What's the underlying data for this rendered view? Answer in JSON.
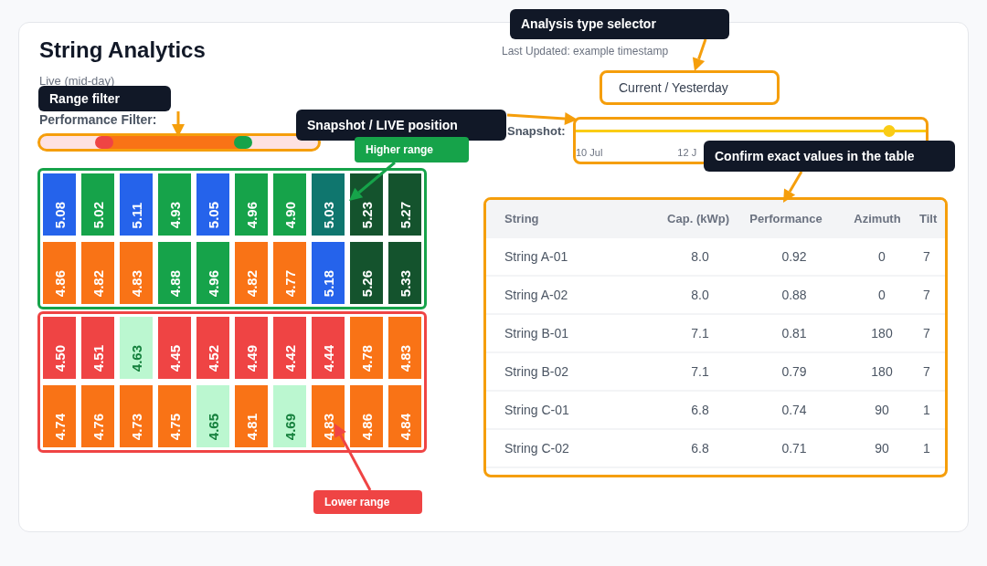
{
  "title": "String Analytics",
  "mode_label": "Live (mid-day)",
  "filter": {
    "label": "Performance Filter:",
    "thumbs": [
      {
        "level": 0.23,
        "color": "#ef4444"
      },
      {
        "level": 0.73,
        "color": "#16a34a"
      }
    ]
  },
  "heatmap_groups": [
    {
      "kind": "higher",
      "rows": [
        [
          {
            "value": "5.08",
            "color": "#2563eb"
          },
          {
            "value": "5.02",
            "color": "#16a34a"
          },
          {
            "value": "5.11",
            "color": "#2563eb"
          },
          {
            "value": "4.93",
            "color": "#16a34a"
          },
          {
            "value": "5.05",
            "color": "#2563eb"
          },
          {
            "value": "4.96",
            "color": "#16a34a"
          },
          {
            "value": "4.90",
            "color": "#16a34a"
          },
          {
            "value": "5.03",
            "color": "#0f766e"
          },
          {
            "value": "5.23",
            "color": "#14532d"
          },
          {
            "value": "5.27",
            "color": "#14532d"
          }
        ],
        [
          {
            "value": "4.86",
            "color": "#f97316"
          },
          {
            "value": "4.82",
            "color": "#f97316"
          },
          {
            "value": "4.83",
            "color": "#f97316"
          },
          {
            "value": "4.88",
            "color": "#16a34a"
          },
          {
            "value": "4.96",
            "color": "#16a34a"
          },
          {
            "value": "4.82",
            "color": "#f97316"
          },
          {
            "value": "4.77",
            "color": "#f97316"
          },
          {
            "value": "5.18",
            "color": "#2563eb"
          },
          {
            "value": "5.26",
            "color": "#14532d"
          },
          {
            "value": "5.33",
            "color": "#14532d"
          }
        ]
      ]
    },
    {
      "kind": "lower",
      "rows": [
        [
          {
            "value": "4.50",
            "color": "#ef4444"
          },
          {
            "value": "4.51",
            "color": "#ef4444"
          },
          {
            "value": "4.63",
            "color": "#bbf7d0"
          },
          {
            "value": "4.45",
            "color": "#ef4444"
          },
          {
            "value": "4.52",
            "color": "#ef4444"
          },
          {
            "value": "4.49",
            "color": "#ef4444"
          },
          {
            "value": "4.42",
            "color": "#ef4444"
          },
          {
            "value": "4.44",
            "color": "#ef4444"
          },
          {
            "value": "4.78",
            "color": "#f97316"
          },
          {
            "value": "4.83",
            "color": "#f97316"
          }
        ],
        [
          {
            "value": "4.74",
            "color": "#f97316"
          },
          {
            "value": "4.76",
            "color": "#f97316"
          },
          {
            "value": "4.73",
            "color": "#f97316"
          },
          {
            "value": "4.75",
            "color": "#f97316"
          },
          {
            "value": "4.65",
            "color": "#bbf7d0"
          },
          {
            "value": "4.81",
            "color": "#f97316"
          },
          {
            "value": "4.69",
            "color": "#bbf7d0"
          },
          {
            "value": "4.83",
            "color": "#f97316"
          },
          {
            "value": "4.86",
            "color": "#f97316"
          },
          {
            "value": "4.84",
            "color": "#f97316"
          }
        ]
      ]
    }
  ],
  "last_updated": "Last Updated: example timestamp",
  "analysis_select": {
    "value": "Current / Yesterday"
  },
  "snapshot": {
    "label": "Snapshot:",
    "level": 0.91,
    "ticks": [
      "10 Jul",
      "12 J"
    ]
  },
  "table": {
    "columns": [
      "String",
      "Cap. (kWp)",
      "Performance",
      "Azimuth",
      "Tilt"
    ],
    "rows": [
      [
        "String A-01",
        "8.0",
        "0.92",
        "0",
        "7"
      ],
      [
        "String A-02",
        "8.0",
        "0.88",
        "0",
        "7"
      ],
      [
        "String B-01",
        "7.1",
        "0.81",
        "180",
        "7"
      ],
      [
        "String B-02",
        "7.1",
        "0.79",
        "180",
        "7"
      ],
      [
        "String C-01",
        "6.8",
        "0.74",
        "90",
        "1"
      ],
      [
        "String C-02",
        "6.8",
        "0.71",
        "90",
        "1"
      ]
    ]
  },
  "annotations": [
    {
      "kind": "dark",
      "text": "Range filter"
    },
    {
      "kind": "dark",
      "text": "Analysis type selector"
    },
    {
      "kind": "dark",
      "text": "Snapshot / LIVE position"
    },
    {
      "kind": "green",
      "text": "Higher range"
    },
    {
      "kind": "dark",
      "text": "Confirm exact values in the table"
    },
    {
      "kind": "red",
      "text": "Lower range"
    }
  ]
}
